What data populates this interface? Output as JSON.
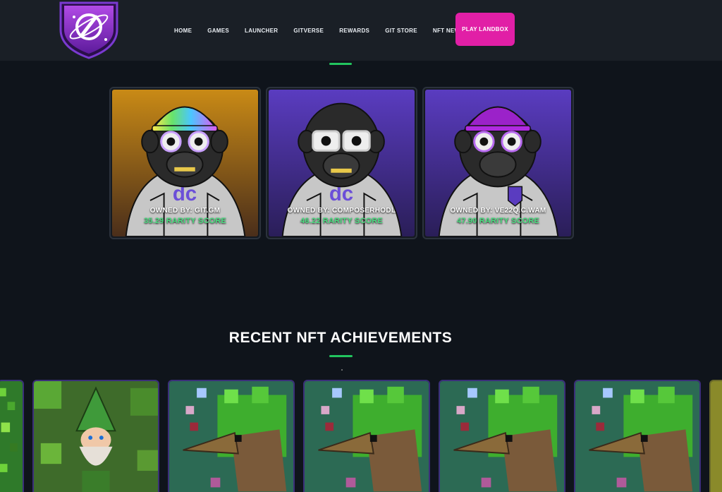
{
  "header": {
    "nav": [
      "HOME",
      "GAMES",
      "LAUNCHER",
      "GITVERSE",
      "REWARDS",
      "GIT STORE",
      "NFT NEWS"
    ],
    "cta": "PLAY LANDBOX"
  },
  "owners": [
    {
      "owner": "OWNED BY: GIT.GM",
      "score": "35.29 RARITY SCORE",
      "bg": "#c98a16",
      "hat": "rainbow"
    },
    {
      "owner": "OWNED BY: COMPOSERHODL",
      "score": "46.22 RARITY SCORE",
      "bg": "#5a3cc0",
      "hat": "none"
    },
    {
      "owner": "OWNED BY: VE22Q.C.WAM",
      "score": "47.90 RARITY SCORE",
      "bg": "#5a3cc0",
      "hat": "purple"
    }
  ],
  "achievements": {
    "title": "RECENT NFT ACHIEVEMENTS",
    "items": [
      "forest-tile",
      "gnome",
      "bird",
      "bird",
      "bird",
      "bird",
      "partial"
    ]
  },
  "colors": {
    "accent": "#22c55e",
    "cta": "#e11fa6",
    "score": "#4ade80"
  }
}
